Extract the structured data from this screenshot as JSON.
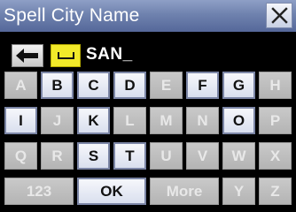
{
  "title": "Spell City Name",
  "close_icon": "close-x-icon",
  "back_icon": "left-arrow-icon",
  "space_icon": "space-bracket-icon",
  "entry_text": "SAN_",
  "colors": {
    "title_gradient_top": "#8e9fc6",
    "title_gradient_bottom": "#55689a",
    "space_key": "#f2ea2a",
    "key_enabled": "#e6eaf5",
    "key_disabled": "#bdbdbd"
  },
  "keys": [
    {
      "label": "A",
      "enabled": false
    },
    {
      "label": "B",
      "enabled": true
    },
    {
      "label": "C",
      "enabled": true
    },
    {
      "label": "D",
      "enabled": true
    },
    {
      "label": "E",
      "enabled": false
    },
    {
      "label": "F",
      "enabled": true
    },
    {
      "label": "G",
      "enabled": true
    },
    {
      "label": "H",
      "enabled": false
    },
    {
      "label": "I",
      "enabled": true
    },
    {
      "label": "J",
      "enabled": false
    },
    {
      "label": "K",
      "enabled": true
    },
    {
      "label": "L",
      "enabled": false
    },
    {
      "label": "M",
      "enabled": false
    },
    {
      "label": "N",
      "enabled": false
    },
    {
      "label": "O",
      "enabled": true
    },
    {
      "label": "P",
      "enabled": false
    },
    {
      "label": "Q",
      "enabled": false
    },
    {
      "label": "R",
      "enabled": false
    },
    {
      "label": "S",
      "enabled": true
    },
    {
      "label": "T",
      "enabled": true
    },
    {
      "label": "U",
      "enabled": false
    },
    {
      "label": "V",
      "enabled": false
    },
    {
      "label": "W",
      "enabled": false
    },
    {
      "label": "X",
      "enabled": false
    },
    {
      "label": "123",
      "enabled": false
    },
    {
      "label": "OK",
      "enabled": true
    },
    {
      "label": "More",
      "enabled": false
    },
    {
      "label": "Y",
      "enabled": false
    },
    {
      "label": "Z",
      "enabled": false
    }
  ]
}
